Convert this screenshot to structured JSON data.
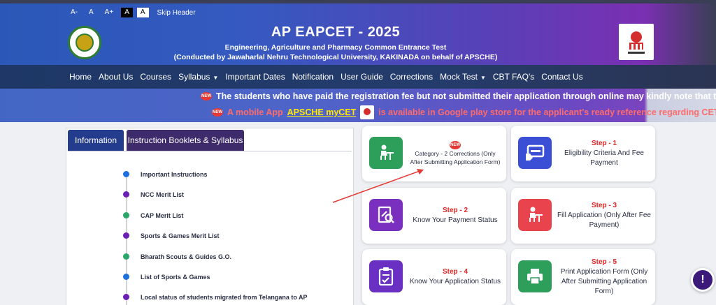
{
  "accessibility": {
    "font_decrease": "A-",
    "font_normal": "A",
    "font_increase": "A+",
    "contrast_dark": "A",
    "contrast_light": "A",
    "skip_header": "Skip Header"
  },
  "header": {
    "title": "AP EAPCET - 2025",
    "subtitle": "Engineering, Agriculture and Pharmacy Common Entrance Test",
    "conducted_by": "(Conducted by Jawaharlal Nehru Technological University, KAKINADA on behalf of APSCHE)",
    "left_logo": "university-seal-icon",
    "right_logo": "apsche-logo-icon"
  },
  "nav": {
    "items": [
      {
        "label": "Home"
      },
      {
        "label": "About Us"
      },
      {
        "label": "Courses"
      },
      {
        "label": "Syllabus",
        "dropdown": true
      },
      {
        "label": "Important Dates"
      },
      {
        "label": "Notification"
      },
      {
        "label": "User Guide"
      },
      {
        "label": "Corrections"
      },
      {
        "label": "Mock Test",
        "dropdown": true
      },
      {
        "label": "CBT FAQ's"
      },
      {
        "label": "Contact Us"
      }
    ]
  },
  "ticker": {
    "badge": "NEW",
    "line1": "The students who have paid the registration fee but not submitted their application through online may kindly note that the last dat",
    "line2_prefix": "A mobile App",
    "line2_app": "APSCHE myCET",
    "line2_suffix": "is available in Google play store for the applicant's ready reference regarding CET related info"
  },
  "info_panel": {
    "tabs": [
      {
        "label": "Information",
        "active": true
      },
      {
        "label": "Instruction Booklets & Syllabus",
        "active": false
      }
    ],
    "items": [
      {
        "label": "Important Instructions",
        "color": "#1e6fe0"
      },
      {
        "label": "NCC Merit List",
        "color": "#6a1fb5"
      },
      {
        "label": "CAP Merit List",
        "color": "#2aa66a"
      },
      {
        "label": "Sports & Games Merit List",
        "color": "#6a1fb5"
      },
      {
        "label": "Bharath Scouts & Guides G.O.",
        "color": "#2aa66a"
      },
      {
        "label": "List of Sports & Games",
        "color": "#1e6fe0"
      },
      {
        "label": "Local status of students migrated from Telangana to AP",
        "color": "#6a1fb5"
      }
    ]
  },
  "cards": {
    "corrections": {
      "badge": "NEW",
      "name": "Category - 2 Corrections (Only After Submitting Application Form)",
      "icon": "student-desk-icon"
    },
    "step1": {
      "step": "Step - 1",
      "name": "Eligibility Criteria And Fee Payment",
      "icon": "card-payment-icon"
    },
    "step2": {
      "step": "Step - 2",
      "name": "Know Your Payment Status",
      "icon": "search-document-icon"
    },
    "step3": {
      "step": "Step - 3",
      "name": "Fill Application (Only After Fee Payment)",
      "icon": "student-desk-icon"
    },
    "step4": {
      "step": "Step - 4",
      "name": "Know Your Application Status",
      "icon": "clipboard-check-icon"
    },
    "step5": {
      "step": "Step - 5",
      "name": "Print Application Form (Only After Submitting Application Form)",
      "icon": "printer-icon"
    }
  },
  "chat": {
    "label": "!"
  },
  "colors": {
    "step_red": "#e02424",
    "nav_bg": "#1e3766",
    "tab_active": "#243c8e",
    "tab_inactive": "#3d2b6b",
    "annotation_arrow": "#e53935"
  }
}
